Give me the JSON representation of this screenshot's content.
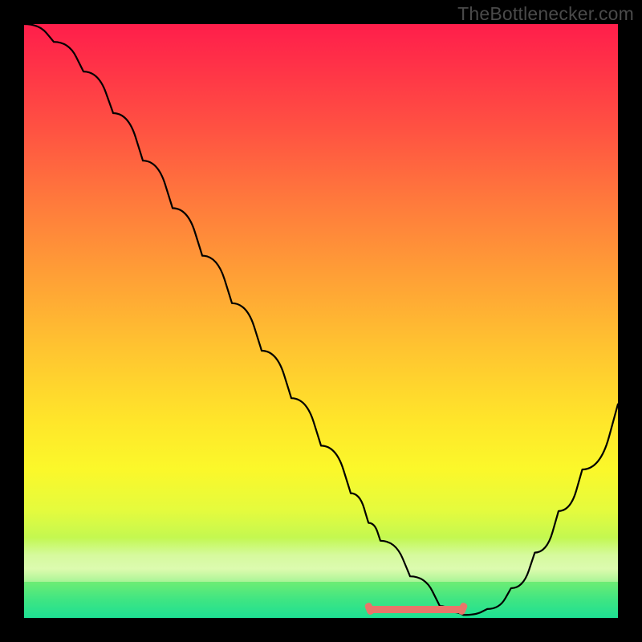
{
  "watermark": "TheBottlenecker.com",
  "chart_data": {
    "type": "line",
    "title": "",
    "xlabel": "",
    "ylabel": "",
    "xlim": [
      0,
      100
    ],
    "ylim": [
      0,
      100
    ],
    "x": [
      0,
      5,
      10,
      15,
      20,
      25,
      30,
      35,
      40,
      45,
      50,
      55,
      58,
      60,
      65,
      70,
      72,
      74,
      78,
      82,
      86,
      90,
      94,
      100
    ],
    "values": [
      100,
      97,
      92,
      85,
      77,
      69,
      61,
      53,
      45,
      37,
      29,
      21,
      16,
      13,
      7,
      2,
      1,
      0.5,
      1.5,
      5,
      11,
      18,
      25,
      36
    ],
    "valley_range_x": [
      58,
      74
    ],
    "annotations": [],
    "background": "red-yellow-green vertical gradient"
  },
  "colors": {
    "curve": "#000000",
    "valley_marker": "#e9756a",
    "frame": "#000000"
  }
}
